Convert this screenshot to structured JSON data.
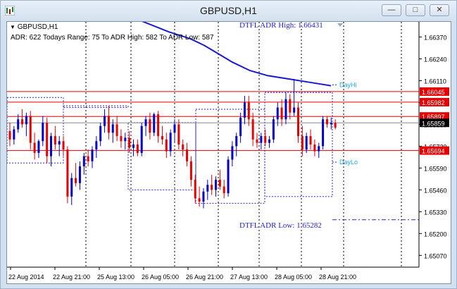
{
  "window": {
    "title": "GBPUSD,H1",
    "buttons": [
      {
        "name": "minimize",
        "glyph": "—"
      },
      {
        "name": "restore",
        "glyph": "□"
      },
      {
        "name": "close",
        "glyph": "✕"
      }
    ]
  },
  "chart_header": {
    "symbol": "GBPUSD,H1",
    "stats_line": "ADR: 622   Todays Range: 75   To ADR High: 582   To ADR Low: 587"
  },
  "chart_data": {
    "type": "candlestick",
    "y_ticks": [
      "1.66370",
      "1.66240",
      "1.66110",
      "1.65980",
      "1.65850",
      "1.65720",
      "1.65590",
      "1.65460",
      "1.65330",
      "1.65200",
      "1.65070"
    ],
    "ylim": [
      1.65,
      1.6646
    ],
    "x_ticks": [
      "22 Aug 2014",
      "22 Aug 21:00",
      "25 Aug 13:00",
      "26 Aug 05:00",
      "26 Aug 21:00",
      "27 Aug 13:00",
      "28 Aug 05:00",
      "28 Aug 21:00"
    ],
    "price_labels": [
      {
        "text": "1.66045",
        "value": 1.66045,
        "bg": "#e60000"
      },
      {
        "text": "1.65982",
        "value": 1.65982,
        "bg": "#e60000"
      },
      {
        "text": "1.65897",
        "value": 1.65897,
        "bg": "#e60000"
      },
      {
        "text": "1.65859",
        "value": 1.65859,
        "bg": "#000000"
      },
      {
        "text": "1.65694",
        "value": 1.65694,
        "bg": "#e60000"
      }
    ],
    "annotations": {
      "adr_high": "DTFL ADR High: 1.66431",
      "adr_low": "DTFL ADR Low: 1.65282",
      "day_hi": "DayHi",
      "day_lo": "DayLo"
    },
    "adr_high_value": 1.66431,
    "adr_low_value": 1.65282,
    "horizontal_lines": [
      1.66045,
      1.65982,
      1.65897,
      1.65859,
      1.65694
    ],
    "candles": [
      {
        "o": 1.6581,
        "h": 1.6586,
        "l": 1.6572,
        "c": 1.6576
      },
      {
        "o": 1.6576,
        "h": 1.6584,
        "l": 1.6573,
        "c": 1.6582
      },
      {
        "o": 1.6582,
        "h": 1.6591,
        "l": 1.658,
        "c": 1.6588
      },
      {
        "o": 1.6588,
        "h": 1.6594,
        "l": 1.6583,
        "c": 1.6585
      },
      {
        "o": 1.6585,
        "h": 1.6592,
        "l": 1.6578,
        "c": 1.659
      },
      {
        "o": 1.659,
        "h": 1.6593,
        "l": 1.657,
        "c": 1.6574
      },
      {
        "o": 1.6574,
        "h": 1.658,
        "l": 1.6564,
        "c": 1.6568
      },
      {
        "o": 1.6568,
        "h": 1.6576,
        "l": 1.6565,
        "c": 1.6575
      },
      {
        "o": 1.6575,
        "h": 1.659,
        "l": 1.6572,
        "c": 1.6586
      },
      {
        "o": 1.6586,
        "h": 1.6589,
        "l": 1.6562,
        "c": 1.6566
      },
      {
        "o": 1.6566,
        "h": 1.658,
        "l": 1.656,
        "c": 1.6578
      },
      {
        "o": 1.6578,
        "h": 1.6584,
        "l": 1.657,
        "c": 1.6573
      },
      {
        "o": 1.6573,
        "h": 1.6578,
        "l": 1.6566,
        "c": 1.6575
      },
      {
        "o": 1.6575,
        "h": 1.6578,
        "l": 1.6566,
        "c": 1.657
      },
      {
        "o": 1.657,
        "h": 1.6572,
        "l": 1.6538,
        "c": 1.6542
      },
      {
        "o": 1.6542,
        "h": 1.6556,
        "l": 1.6537,
        "c": 1.6553
      },
      {
        "o": 1.6553,
        "h": 1.6562,
        "l": 1.6548,
        "c": 1.655
      },
      {
        "o": 1.655,
        "h": 1.6563,
        "l": 1.6546,
        "c": 1.656
      },
      {
        "o": 1.656,
        "h": 1.6568,
        "l": 1.6555,
        "c": 1.6566
      },
      {
        "o": 1.6566,
        "h": 1.657,
        "l": 1.656,
        "c": 1.6563
      },
      {
        "o": 1.6563,
        "h": 1.6572,
        "l": 1.6559,
        "c": 1.657
      },
      {
        "o": 1.657,
        "h": 1.6578,
        "l": 1.6565,
        "c": 1.6575
      },
      {
        "o": 1.6575,
        "h": 1.6586,
        "l": 1.6572,
        "c": 1.6584
      },
      {
        "o": 1.6584,
        "h": 1.6594,
        "l": 1.658,
        "c": 1.659
      },
      {
        "o": 1.659,
        "h": 1.6596,
        "l": 1.6576,
        "c": 1.658
      },
      {
        "o": 1.658,
        "h": 1.6588,
        "l": 1.6574,
        "c": 1.6585
      },
      {
        "o": 1.6585,
        "h": 1.659,
        "l": 1.6575,
        "c": 1.6578
      },
      {
        "o": 1.6578,
        "h": 1.6582,
        "l": 1.6571,
        "c": 1.6575
      },
      {
        "o": 1.6575,
        "h": 1.658,
        "l": 1.657,
        "c": 1.6577
      },
      {
        "o": 1.6577,
        "h": 1.6581,
        "l": 1.6568,
        "c": 1.6571
      },
      {
        "o": 1.6571,
        "h": 1.6576,
        "l": 1.6566,
        "c": 1.6573
      },
      {
        "o": 1.6573,
        "h": 1.6576,
        "l": 1.6566,
        "c": 1.6568
      },
      {
        "o": 1.6568,
        "h": 1.6586,
        "l": 1.6566,
        "c": 1.6584
      },
      {
        "o": 1.6584,
        "h": 1.659,
        "l": 1.6578,
        "c": 1.6588
      },
      {
        "o": 1.6588,
        "h": 1.6592,
        "l": 1.6576,
        "c": 1.658
      },
      {
        "o": 1.658,
        "h": 1.6592,
        "l": 1.6578,
        "c": 1.6591
      },
      {
        "o": 1.6591,
        "h": 1.6593,
        "l": 1.6574,
        "c": 1.6578
      },
      {
        "o": 1.6578,
        "h": 1.6584,
        "l": 1.6573,
        "c": 1.6576
      },
      {
        "o": 1.6576,
        "h": 1.658,
        "l": 1.6565,
        "c": 1.6569
      },
      {
        "o": 1.6569,
        "h": 1.6582,
        "l": 1.6566,
        "c": 1.658
      },
      {
        "o": 1.658,
        "h": 1.6588,
        "l": 1.6574,
        "c": 1.6585
      },
      {
        "o": 1.6585,
        "h": 1.6588,
        "l": 1.657,
        "c": 1.6573
      },
      {
        "o": 1.6573,
        "h": 1.6576,
        "l": 1.6566,
        "c": 1.657
      },
      {
        "o": 1.657,
        "h": 1.6574,
        "l": 1.656,
        "c": 1.6563
      },
      {
        "o": 1.6563,
        "h": 1.6566,
        "l": 1.6548,
        "c": 1.6552
      },
      {
        "o": 1.6552,
        "h": 1.6555,
        "l": 1.6538,
        "c": 1.6541
      },
      {
        "o": 1.6541,
        "h": 1.6548,
        "l": 1.6536,
        "c": 1.6539
      },
      {
        "o": 1.6539,
        "h": 1.6547,
        "l": 1.6535,
        "c": 1.6545
      },
      {
        "o": 1.6545,
        "h": 1.6552,
        "l": 1.654,
        "c": 1.6549
      },
      {
        "o": 1.6549,
        "h": 1.6555,
        "l": 1.6543,
        "c": 1.6546
      },
      {
        "o": 1.6546,
        "h": 1.6554,
        "l": 1.6542,
        "c": 1.6552
      },
      {
        "o": 1.6552,
        "h": 1.6558,
        "l": 1.6546,
        "c": 1.6548
      },
      {
        "o": 1.6548,
        "h": 1.6552,
        "l": 1.6541,
        "c": 1.6544
      },
      {
        "o": 1.6544,
        "h": 1.6566,
        "l": 1.6542,
        "c": 1.6564
      },
      {
        "o": 1.6564,
        "h": 1.6575,
        "l": 1.656,
        "c": 1.6572
      },
      {
        "o": 1.6572,
        "h": 1.658,
        "l": 1.6566,
        "c": 1.6578
      },
      {
        "o": 1.6578,
        "h": 1.6592,
        "l": 1.6574,
        "c": 1.6589
      },
      {
        "o": 1.6589,
        "h": 1.6602,
        "l": 1.6585,
        "c": 1.6598
      },
      {
        "o": 1.6598,
        "h": 1.6602,
        "l": 1.6584,
        "c": 1.6588
      },
      {
        "o": 1.6588,
        "h": 1.6592,
        "l": 1.6572,
        "c": 1.6576
      },
      {
        "o": 1.6576,
        "h": 1.658,
        "l": 1.6571,
        "c": 1.6574
      },
      {
        "o": 1.6574,
        "h": 1.658,
        "l": 1.657,
        "c": 1.6578
      },
      {
        "o": 1.6578,
        "h": 1.6582,
        "l": 1.6572,
        "c": 1.6574
      },
      {
        "o": 1.6574,
        "h": 1.6578,
        "l": 1.6571,
        "c": 1.6576
      },
      {
        "o": 1.6576,
        "h": 1.659,
        "l": 1.6574,
        "c": 1.6588
      },
      {
        "o": 1.6588,
        "h": 1.6598,
        "l": 1.6584,
        "c": 1.6595
      },
      {
        "o": 1.6595,
        "h": 1.66,
        "l": 1.6584,
        "c": 1.6588
      },
      {
        "o": 1.6588,
        "h": 1.6604,
        "l": 1.6585,
        "c": 1.66
      },
      {
        "o": 1.66,
        "h": 1.6603,
        "l": 1.6588,
        "c": 1.6592
      },
      {
        "o": 1.6592,
        "h": 1.6612,
        "l": 1.659,
        "c": 1.6595
      },
      {
        "o": 1.6595,
        "h": 1.6598,
        "l": 1.6574,
        "c": 1.6578
      },
      {
        "o": 1.6578,
        "h": 1.6584,
        "l": 1.6566,
        "c": 1.657
      },
      {
        "o": 1.657,
        "h": 1.658,
        "l": 1.6568,
        "c": 1.6578
      },
      {
        "o": 1.6578,
        "h": 1.6582,
        "l": 1.657,
        "c": 1.6573
      },
      {
        "o": 1.6573,
        "h": 1.6576,
        "l": 1.6566,
        "c": 1.6569
      },
      {
        "o": 1.6569,
        "h": 1.6574,
        "l": 1.6565,
        "c": 1.6572
      },
      {
        "o": 1.6572,
        "h": 1.659,
        "l": 1.657,
        "c": 1.6588
      },
      {
        "o": 1.6588,
        "h": 1.659,
        "l": 1.6583,
        "c": 1.6585
      },
      {
        "o": 1.6585,
        "h": 1.6589,
        "l": 1.6582,
        "c": 1.6586
      },
      {
        "o": 1.6586,
        "h": 1.6588,
        "l": 1.6582,
        "c": 1.6583
      }
    ],
    "ma_line": [
      [
        0,
        1.665
      ],
      [
        60,
        1.664
      ],
      [
        90,
        1.6636
      ],
      [
        110,
        1.6632
      ],
      [
        130,
        1.6627
      ],
      [
        150,
        1.6622
      ],
      [
        175,
        1.6617
      ],
      [
        200,
        1.6614
      ],
      [
        230,
        1.6612
      ],
      [
        260,
        1.661
      ],
      [
        290,
        1.6608
      ]
    ],
    "colors": {
      "up": "#0000cc",
      "down": "#e60000",
      "ma": "#1a1acc",
      "grid": "#000000",
      "level": "#e60000",
      "adr": "#2222cc"
    }
  }
}
